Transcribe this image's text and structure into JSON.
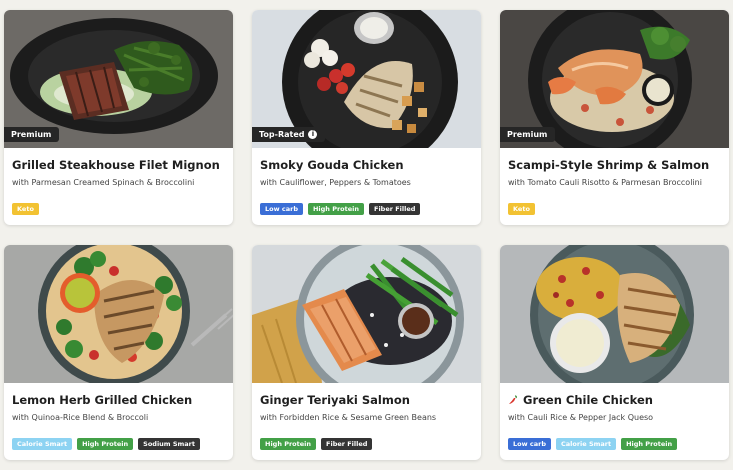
{
  "colors": {
    "Keto": "#f2c232",
    "Low carb": "#3a6ed6",
    "High Protein": "#43a047",
    "Fiber Filled": "#343434",
    "Calorie Smart": "#8dd3f2",
    "Sodium Smart": "#343434",
    "badge_bg": "#262626"
  },
  "meals": [
    {
      "name": "Grilled Steakhouse Filet Mignon",
      "description": "with Parmesan Creamed Spinach & Broccolini",
      "badge": "Premium",
      "tags": [
        "Keto"
      ]
    },
    {
      "name": "Smoky Gouda Chicken",
      "description": "with Cauliflower, Peppers & Tomatoes",
      "badge": "Top-Rated",
      "badge_icon": "info-icon",
      "tags": [
        "Low carb",
        "High Protein",
        "Fiber Filled"
      ]
    },
    {
      "name": "Scampi-Style Shrimp & Salmon",
      "description": "with Tomato Cauli Risotto & Parmesan Broccolini",
      "badge": "Premium",
      "tags": [
        "Keto"
      ]
    },
    {
      "name": "Lemon Herb Grilled Chicken",
      "description": "with Quinoa-Rice Blend & Broccoli",
      "tags": [
        "Calorie Smart",
        "High Protein",
        "Sodium Smart"
      ]
    },
    {
      "name": "Ginger Teriyaki Salmon",
      "description": "with Forbidden Rice & Sesame Green Beans",
      "tags": [
        "High Protein",
        "Fiber Filled"
      ]
    },
    {
      "name": "Green Chile Chicken",
      "description": "with Cauli Rice & Pepper Jack Queso",
      "title_icon": "chili-pepper-icon",
      "tags": [
        "Low carb",
        "Calorie Smart",
        "High Protein"
      ]
    }
  ]
}
